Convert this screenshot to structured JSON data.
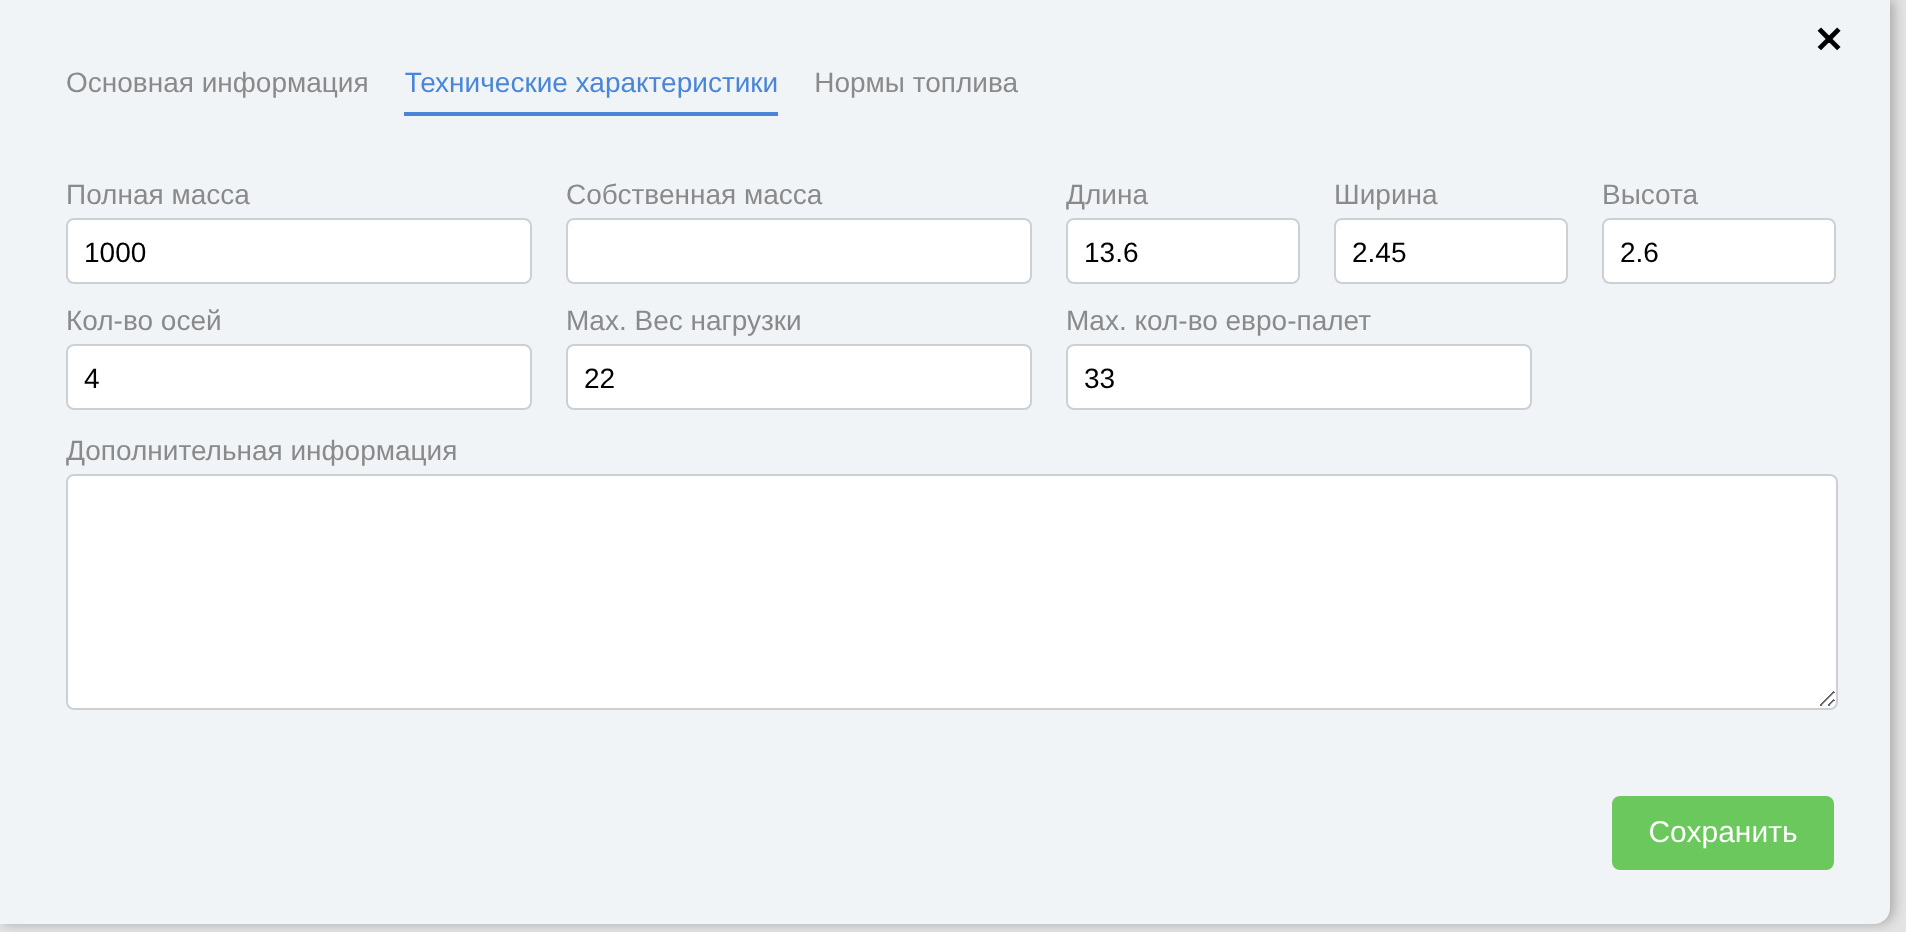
{
  "tabs": [
    {
      "label": "Основная информация",
      "selected": false
    },
    {
      "label": "Технические характеристики",
      "selected": true
    },
    {
      "label": "Нормы топлива",
      "selected": false
    }
  ],
  "close": {
    "label": "✕"
  },
  "field_rows": [
    [
      {
        "label": "Полная масса",
        "value": "1000"
      },
      {
        "label": "Собственная масса"
      },
      {
        "label": "Длина",
        "value": "13.6"
      },
      {
        "label": "Ширина",
        "value": "2.45"
      },
      {
        "label": "Высота",
        "value": "2.6"
      }
    ],
    [
      {
        "label": "Кол-во осей",
        "value": "4"
      },
      {
        "label": "Max. Вес нагрузки",
        "value": "22"
      },
      {
        "label": "Max. кол-во евро-палет",
        "value": "33"
      }
    ]
  ],
  "notes": {
    "label": "Дополнительная информация"
  },
  "save_button": "Сохранить"
}
